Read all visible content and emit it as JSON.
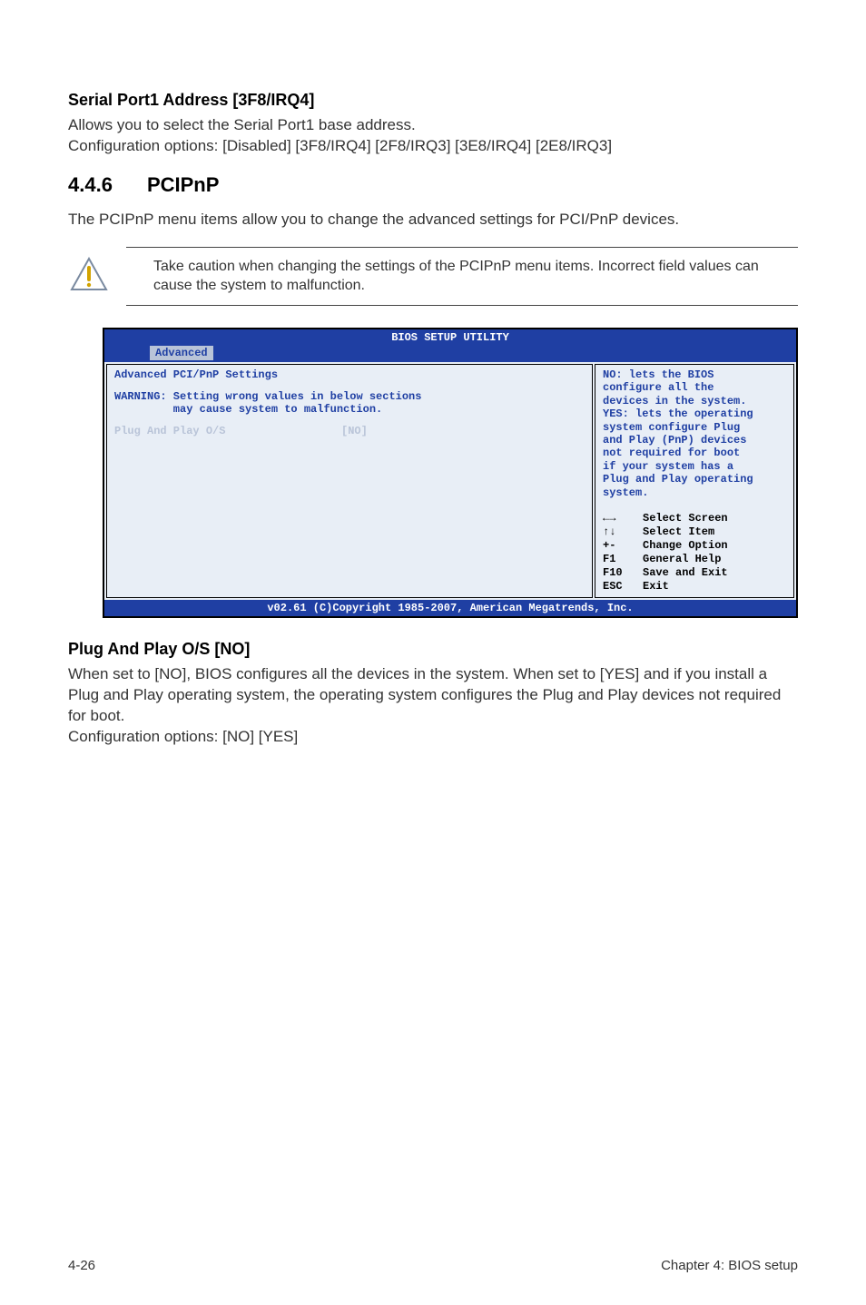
{
  "sec1": {
    "title": "Serial Port1 Address [3F8/IRQ4]",
    "p1": "Allows you to select the Serial Port1 base address.",
    "p2": "Configuration options: [Disabled] [3F8/IRQ4] [2F8/IRQ3] [3E8/IRQ4] [2E8/IRQ3]"
  },
  "sec2": {
    "num": "4.4.6",
    "title": "PCIPnP",
    "p1": "The PCIPnP menu items allow you to change the advanced settings for PCI/PnP devices.",
    "caution": "Take caution when changing the settings of the PCIPnP menu items. Incorrect field values can cause the system to malfunction."
  },
  "bios": {
    "top": "BIOS SETUP UTILITY",
    "tab": "Advanced",
    "left_heading": "Advanced PCI/PnP Settings",
    "warning_l1": "WARNING: Setting wrong values in below sections",
    "warning_l2": "         may cause system to malfunction.",
    "item_label": "Plug And Play O/S",
    "item_val": "[NO]",
    "help": "NO: lets the BIOS\nconfigure all the\ndevices in the system.\nYES: lets the operating\nsystem configure Plug\nand Play (PnP) devices\nnot required for boot\nif your system has a\nPlug and Play operating\nsystem.",
    "legend": [
      {
        "key": "←→",
        "label": "Select Screen"
      },
      {
        "key": "↑↓",
        "label": "Select Item"
      },
      {
        "key": "+-",
        "label": "Change Option"
      },
      {
        "key": "F1",
        "label": "General Help"
      },
      {
        "key": "F10",
        "label": "Save and Exit"
      },
      {
        "key": "ESC",
        "label": "Exit"
      }
    ],
    "footer": "v02.61 (C)Copyright 1985-2007, American Megatrends, Inc."
  },
  "sec3": {
    "title": "Plug And Play O/S [NO]",
    "p1": "When set to [NO], BIOS configures all the devices in the system. When set to [YES] and if you install a Plug and Play operating system, the operating system configures the Plug and Play devices not required for boot.",
    "p2": "Configuration options: [NO] [YES]"
  },
  "footer": {
    "left": "4-26",
    "right": "Chapter 4: BIOS setup"
  }
}
